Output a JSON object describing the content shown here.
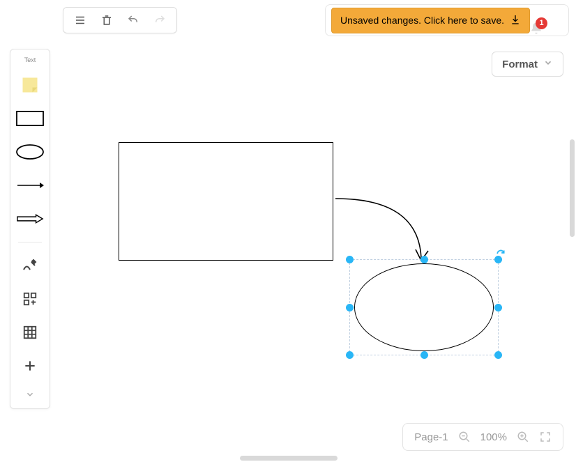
{
  "banner": {
    "text": "Unsaved changes. Click here to save."
  },
  "notifications": {
    "count": "1"
  },
  "format": {
    "label": "Format"
  },
  "sidebar": {
    "text_label": "Text"
  },
  "status": {
    "page": "Page-1",
    "zoom": "100%"
  }
}
